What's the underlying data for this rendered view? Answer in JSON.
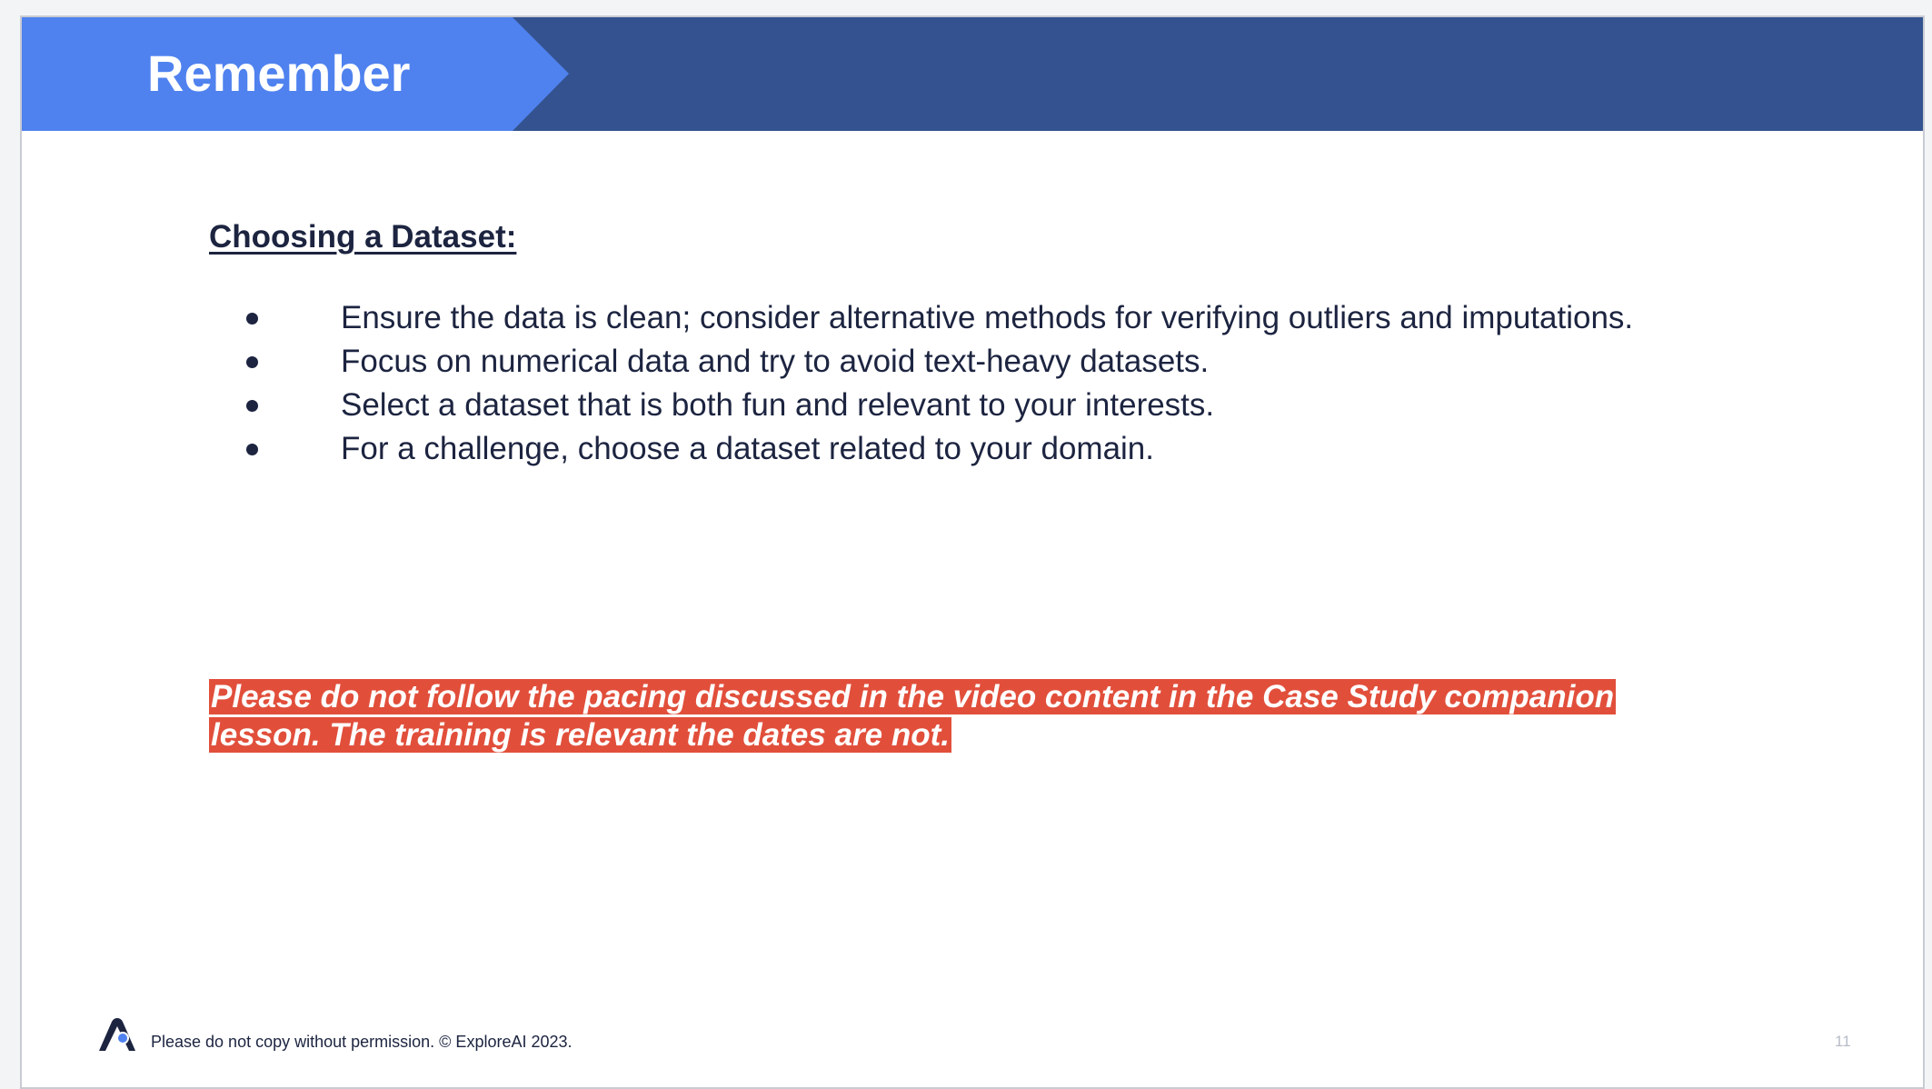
{
  "header": {
    "title": "Remember"
  },
  "content": {
    "heading": "Choosing a Dataset:",
    "bullets": [
      "Ensure the data is clean; consider alternative methods for verifying outliers and imputations.",
      "Focus on numerical data and try to avoid text-heavy datasets.",
      "Select a dataset that is both fun and relevant to your interests.",
      "For a challenge, choose a dataset related to your domain."
    ],
    "warning": "Please do not follow the pacing discussed in the video content  in the Case Study companion lesson. The training is relevant the dates are not."
  },
  "footer": {
    "copyright": "Please do not copy without permission. © ExploreAI 2023.",
    "page_number": "11",
    "logo_icon": "explore-ai-logo-icon"
  },
  "colors": {
    "header_dark": "#33528f",
    "header_tab": "#4f82ef",
    "text": "#1c2440",
    "warning_bg": "#e14f3b"
  }
}
